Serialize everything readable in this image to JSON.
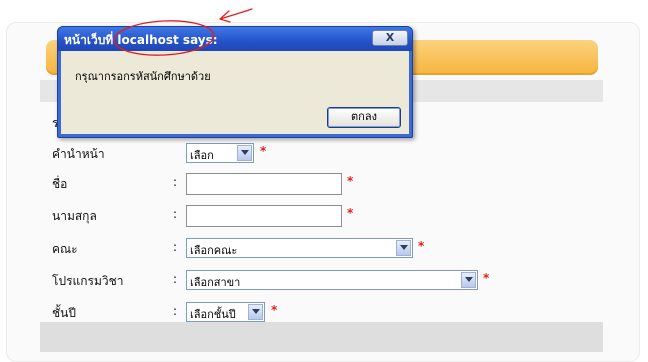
{
  "dialog": {
    "title_prefix": "หน้าเว็บที่",
    "title": "localhost says:",
    "close_glyph": "X",
    "message": "กรุณากรอกรหัสนักศึกษาด้วย",
    "ok_label": "ตกลง"
  },
  "form": {
    "hidden_first_label": "ร",
    "required_mark": "*",
    "colon": ":",
    "fields": [
      {
        "label": "คำนำหน้า",
        "value": "เลือก",
        "type": "select"
      },
      {
        "label": "ชื่อ",
        "value": "",
        "type": "text"
      },
      {
        "label": "นามสกุล",
        "value": "",
        "type": "text"
      },
      {
        "label": "คณะ",
        "value": "เลือกคณะ",
        "type": "select"
      },
      {
        "label": "โปรแกรมวิชา",
        "value": "เลือกสาขา",
        "type": "select"
      },
      {
        "label": "ชั้นปี",
        "value": "เลือกชั้นปี",
        "type": "select"
      }
    ]
  },
  "colors": {
    "accent_orange": "#f6b43e",
    "dialog_blue": "#2552c7",
    "required_red": "#e0201f",
    "annotation_red": "#e0201f"
  }
}
